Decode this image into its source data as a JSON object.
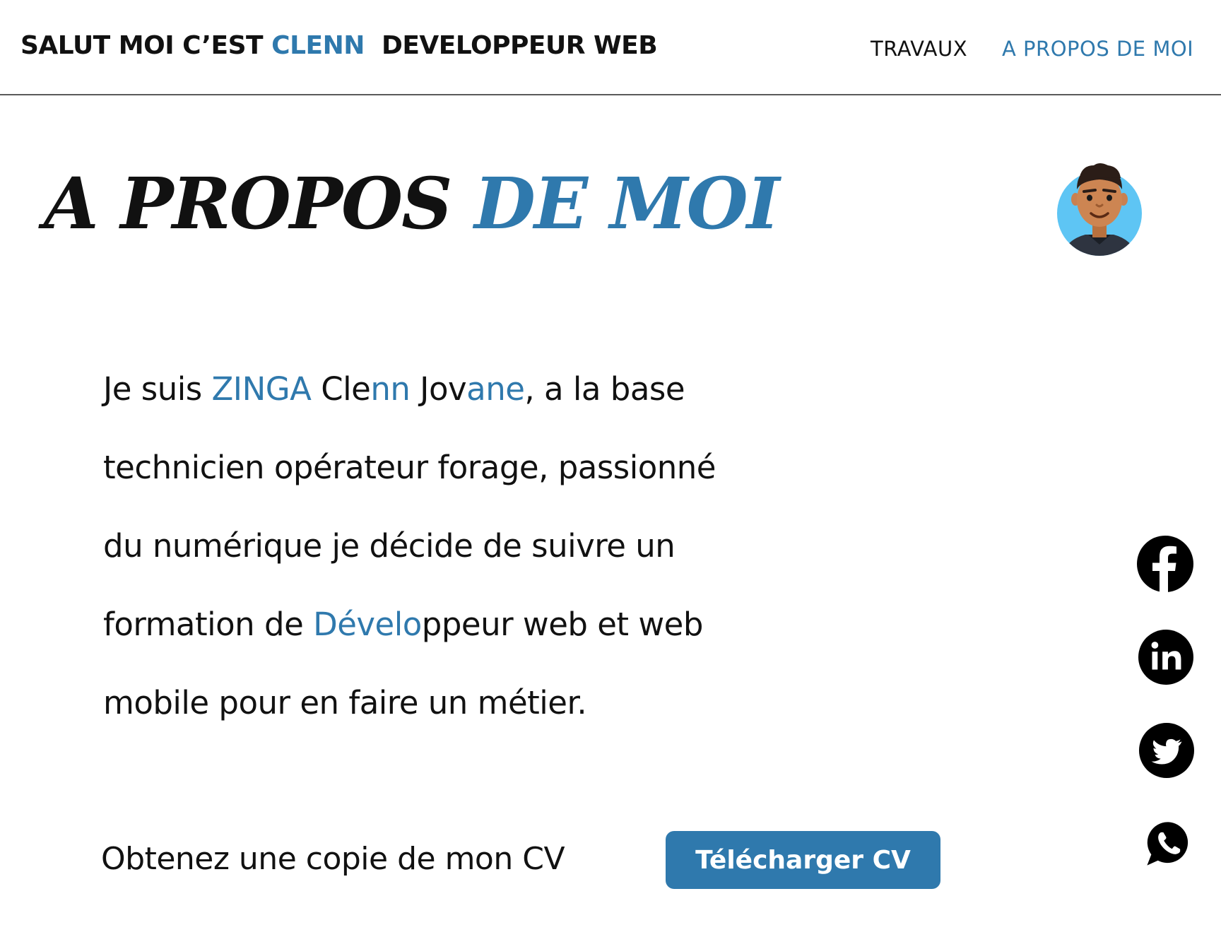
{
  "header": {
    "brand": {
      "part1": "SALUT MOI C’EST ",
      "part2": "CLENN",
      "part3": "  DEVELOPPEUR WEB"
    },
    "nav": {
      "travaux": "TRAVAUX",
      "about": "A PROPOS DE MOI"
    }
  },
  "title": {
    "part1": "A PROPOS ",
    "part2": "DE MOI"
  },
  "bio": {
    "line1": [
      {
        "text": "Je suis ",
        "accent": false
      },
      {
        "text": "ZINGA",
        "accent": true
      },
      {
        "text": " Cle",
        "accent": false
      },
      {
        "text": "nn",
        "accent": true
      },
      {
        "text": " Jov",
        "accent": false
      },
      {
        "text": "ane",
        "accent": true
      },
      {
        "text": ", a la base",
        "accent": false
      }
    ],
    "line2": "technicien opérateur forage, passionné",
    "line3": "du numérique je décide de suivre un",
    "line4": [
      {
        "text": "formation de ",
        "accent": false
      },
      {
        "text": "Dévelo",
        "accent": true
      },
      {
        "text": "ppeur web et web",
        "accent": false
      }
    ],
    "line5": "mobile pour en faire un métier."
  },
  "cv": {
    "text": "Obtenez une copie de mon CV",
    "button_label": "Télécharger CV"
  },
  "social": {
    "icons": [
      "facebook-icon",
      "linkedin-icon",
      "twitter-icon",
      "whatsapp-icon"
    ]
  },
  "colors": {
    "accent": "#2f79ad",
    "text": "#111111",
    "background": "#ffffff",
    "avatar_bg": "#5ec5f4"
  }
}
